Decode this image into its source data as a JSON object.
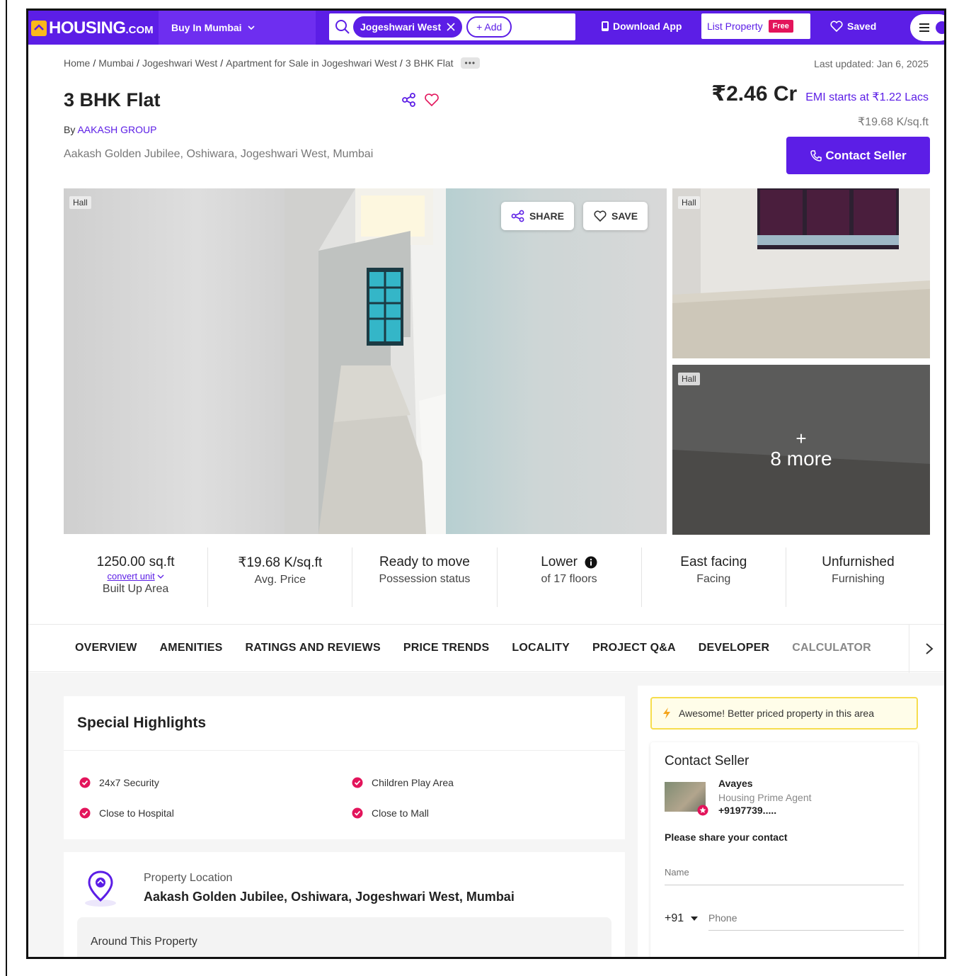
{
  "header": {
    "logo_main": "HOUSING",
    "logo_suffix": ".COM",
    "city_menu": "Buy In Mumbai",
    "search_chip": "Jogeshwari West",
    "add_chip": "+ Add",
    "download_app": "Download App",
    "list_property": "List Property",
    "free_badge": "Free",
    "saved": "Saved"
  },
  "breadcrumb": {
    "items": [
      "Home",
      "Mumbai",
      "Jogeshwari West",
      "Apartment for Sale in Jogeshwari West",
      "3 BHK Flat"
    ],
    "more": "•••"
  },
  "last_updated": "Last updated: Jan 6, 2025",
  "listing": {
    "title": "3 BHK Flat",
    "by_label": "By",
    "developer": "AAKASH GROUP",
    "address": "Aakash Golden Jubilee, Oshiwara, Jogeshwari West, Mumbai",
    "price": "₹2.46 Cr",
    "emi": "EMI starts at ₹1.22 Lacs",
    "price_per_sqft": "₹19.68 K/sq.ft",
    "contact_button": "Contact Seller"
  },
  "gallery": {
    "main_tag": "Hall",
    "share_button": "SHARE",
    "save_button": "SAVE",
    "side1_tag": "Hall",
    "side2_tag": "Hall",
    "more_plus": "+",
    "more_label": "8 more"
  },
  "stats": [
    {
      "value": "1250.00 sq.ft",
      "sub": "convert unit",
      "label": "Built Up Area"
    },
    {
      "value": "₹19.68 K/sq.ft",
      "label": "Avg. Price"
    },
    {
      "value": "Ready to move",
      "label": "Possession status"
    },
    {
      "value": "Lower",
      "label": "of 17 floors"
    },
    {
      "value": "East facing",
      "label": "Facing"
    },
    {
      "value": "Unfurnished",
      "label": "Furnishing"
    }
  ],
  "tabs": [
    "OVERVIEW",
    "AMENITIES",
    "RATINGS AND REVIEWS",
    "PRICE TRENDS",
    "LOCALITY",
    "PROJECT Q&A",
    "DEVELOPER",
    "CALCULATOR"
  ],
  "highlights": {
    "title": "Special Highlights",
    "items": [
      "24x7 Security",
      "Children Play Area",
      "Close to Hospital",
      "Close to Mall"
    ]
  },
  "location": {
    "label": "Property Location",
    "value": "Aakash Golden Jubilee, Oshiwara, Jogeshwari West, Mumbai",
    "around": "Around This Property"
  },
  "sidebar": {
    "awesome": "Awesome! Better priced property in this area",
    "contact_title": "Contact Seller",
    "agent_name": "Avayes",
    "agent_role": "Housing Prime Agent",
    "agent_phone": "+9197739.....",
    "share_prompt": "Please share your contact",
    "name_placeholder": "Name",
    "country_code": "+91",
    "phone_placeholder": "Phone"
  },
  "colors": {
    "brand": "#5c1ee6",
    "accent_pink": "#e3145b",
    "logo_yellow": "#fbb81b"
  }
}
